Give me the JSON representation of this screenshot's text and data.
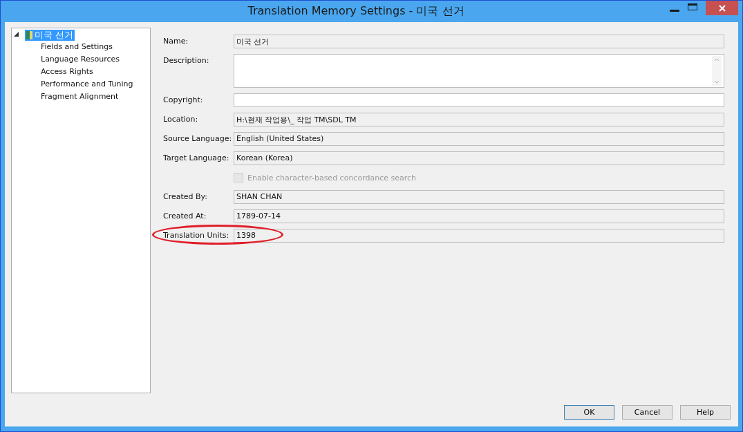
{
  "window": {
    "title": "Translation Memory Settings - 미국 선거"
  },
  "tree": {
    "label": "미국 선거",
    "selected": true,
    "expanded": true,
    "children": [
      {
        "label": "Fields and Settings",
        "selected": false
      },
      {
        "label": "Language Resources",
        "selected": false
      },
      {
        "label": "Access Rights",
        "selected": false
      },
      {
        "label": "Performance and Tuning",
        "selected": false
      },
      {
        "label": "Fragment Alignment",
        "selected": false
      }
    ]
  },
  "fields": [
    {
      "kind": "text",
      "label": "Name:",
      "value": "미국 선거",
      "editable": false
    },
    {
      "kind": "textarea",
      "label": "Description:",
      "editable": true
    },
    {
      "kind": "text",
      "label": "Copyright:",
      "editable": true
    },
    {
      "kind": "text",
      "label": "Location:",
      "value": "H:\\현재 작업용\\_ 작업 TM\\SDL TM",
      "editable": false
    },
    {
      "kind": "text",
      "label": "Source Language:",
      "value": "English (United States)",
      "editable": false
    },
    {
      "kind": "text",
      "label": "Target Language:",
      "value": "Korean (Korea)",
      "editable": false
    },
    {
      "kind": "checkbox",
      "label": "Enable character-based concordance search",
      "checked": false,
      "disabled": true
    },
    {
      "kind": "text",
      "label": "Created By:",
      "value": "SHAN CHAN",
      "editable": false
    },
    {
      "kind": "text",
      "label": "Created At:",
      "value": "1789-07-14",
      "editable": false
    },
    {
      "kind": "text",
      "label": "Translation Units:",
      "value": "1398",
      "editable": false,
      "highlighted": true
    }
  ],
  "buttons": [
    {
      "label": "OK",
      "default": true
    },
    {
      "label": "Cancel",
      "default": false
    },
    {
      "label": "Help",
      "default": false
    }
  ]
}
